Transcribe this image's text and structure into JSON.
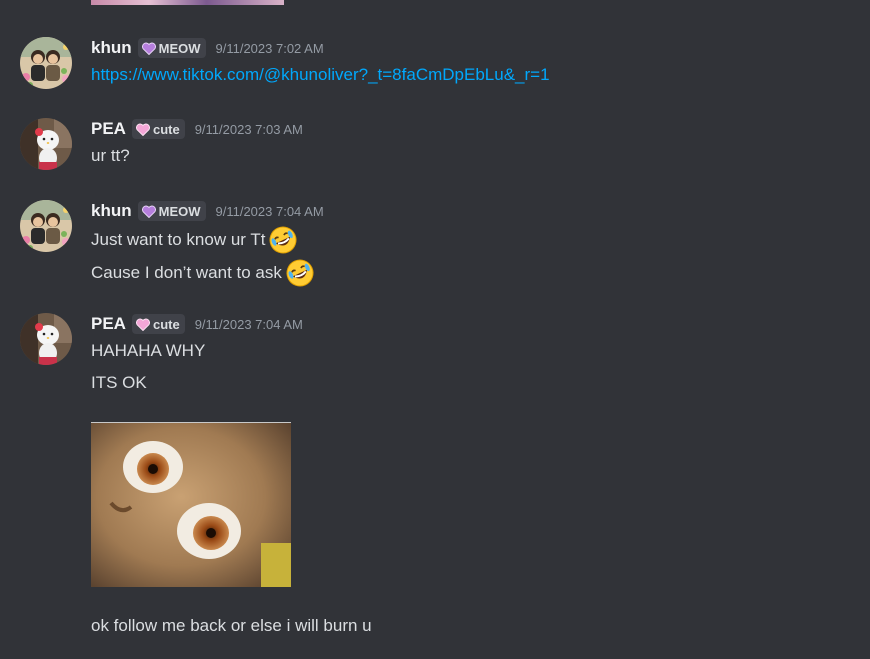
{
  "messages": [
    {
      "username": "khun",
      "tag": "MEOW",
      "timestamp": "9/11/2023 7:02 AM",
      "lines": [
        "https://www.tiktok.com/@khunoliver?_t=8faCmDpEbLu&_r=1"
      ]
    },
    {
      "username": "PEA",
      "tag": "cute",
      "timestamp": "9/11/2023 7:03 AM",
      "lines": [
        "ur tt?"
      ]
    },
    {
      "username": "khun",
      "tag": "MEOW",
      "timestamp": "9/11/2023 7:04 AM",
      "lines": [
        "Just want to know ur Tt",
        "Cause I don’t want to ask"
      ]
    },
    {
      "username": "PEA",
      "tag": "cute",
      "timestamp": "9/11/2023 7:04 AM",
      "lines": [
        "HAHAHA WHY",
        "ITS OK",
        "ok follow me back or else i will burn u"
      ]
    }
  ],
  "icons": {
    "tag_meow": "purple-heart-icon",
    "tag_cute": "pink-heart-icon",
    "laugh_emoji": "rolling-on-floor-laughing-emoji"
  },
  "colors": {
    "background": "#313338",
    "link": "#00a8fc",
    "username": "#f2f3f5",
    "timestamp": "#949ba4",
    "tag_bg": "#404249",
    "meow_heart": "#b57edc",
    "cute_heart": "#f4a6d7"
  }
}
